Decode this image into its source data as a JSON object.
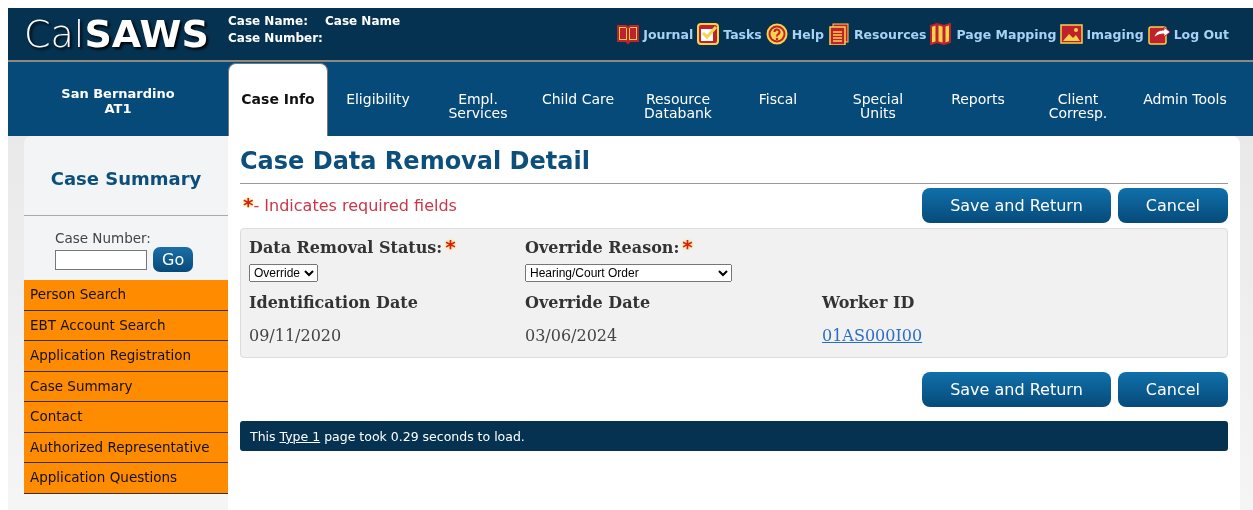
{
  "header": {
    "logo": "Cal**SAWS**",
    "case_name_label": "Case Name:",
    "case_name_value": "Case Name",
    "case_number_label": "Case Number:",
    "links": [
      {
        "label": "Journal",
        "kind": "book"
      },
      {
        "label": "Tasks",
        "kind": "checkbox"
      },
      {
        "label": "Help",
        "kind": "question"
      },
      {
        "label": "Resources",
        "kind": "document"
      },
      {
        "label": "Page Mapping",
        "kind": "map"
      },
      {
        "label": "Imaging",
        "kind": "image"
      },
      {
        "label": "Log Out",
        "kind": "exit"
      }
    ]
  },
  "nav": {
    "county": "San Bernardino",
    "office": "AT1",
    "tabs": [
      {
        "label": "Case Info",
        "selected": true
      },
      {
        "label": "Eligibility",
        "selected": false
      },
      {
        "label": "Empl. Services",
        "selected": false
      },
      {
        "label": "Child Care",
        "selected": false
      },
      {
        "label": "Resource Databank",
        "selected": false
      },
      {
        "label": "Fiscal",
        "selected": false
      },
      {
        "label": "Special Units",
        "selected": false
      },
      {
        "label": "Reports",
        "selected": false
      },
      {
        "label": "Client Corresp.",
        "selected": false
      },
      {
        "label": "Admin Tools",
        "selected": false
      }
    ]
  },
  "sidebar": {
    "title": "Case Summary",
    "case_number_label": "Case Number:",
    "go_button": "Go",
    "items": [
      {
        "label": "Person Search"
      },
      {
        "label": "EBT Account Search"
      },
      {
        "label": "Application Registration"
      },
      {
        "label": "Case Summary"
      },
      {
        "label": "Contact"
      },
      {
        "label": "Authorized Representative"
      },
      {
        "label": "Application Questions"
      }
    ]
  },
  "page": {
    "title": "Case Data Removal Detail",
    "required_mark": "*",
    "required_note": "- Indicates required fields",
    "buttons": [
      {
        "label": "Save and Return"
      },
      {
        "label": "Cancel"
      }
    ],
    "fields": [
      {
        "kind": "select",
        "label": "Data Removal Status:",
        "required": true,
        "value": "Override"
      },
      {
        "kind": "select",
        "label": "Override Reason:",
        "required": true,
        "value": "Hearing/Court Order"
      },
      {
        "kind": "text",
        "label": "Identification Date",
        "value": "09/11/2020"
      },
      {
        "kind": "text",
        "label": "Override Date",
        "value": "03/06/2024"
      },
      {
        "kind": "link",
        "label": "Worker ID",
        "value": "01AS000I00"
      }
    ],
    "bottom_buttons": [
      {
        "label": "Save and Return"
      },
      {
        "label": "Cancel"
      }
    ],
    "footer": {
      "prefix": "This",
      "link": "Type 1",
      "suffix": "page took 0.29 seconds to load."
    }
  }
}
